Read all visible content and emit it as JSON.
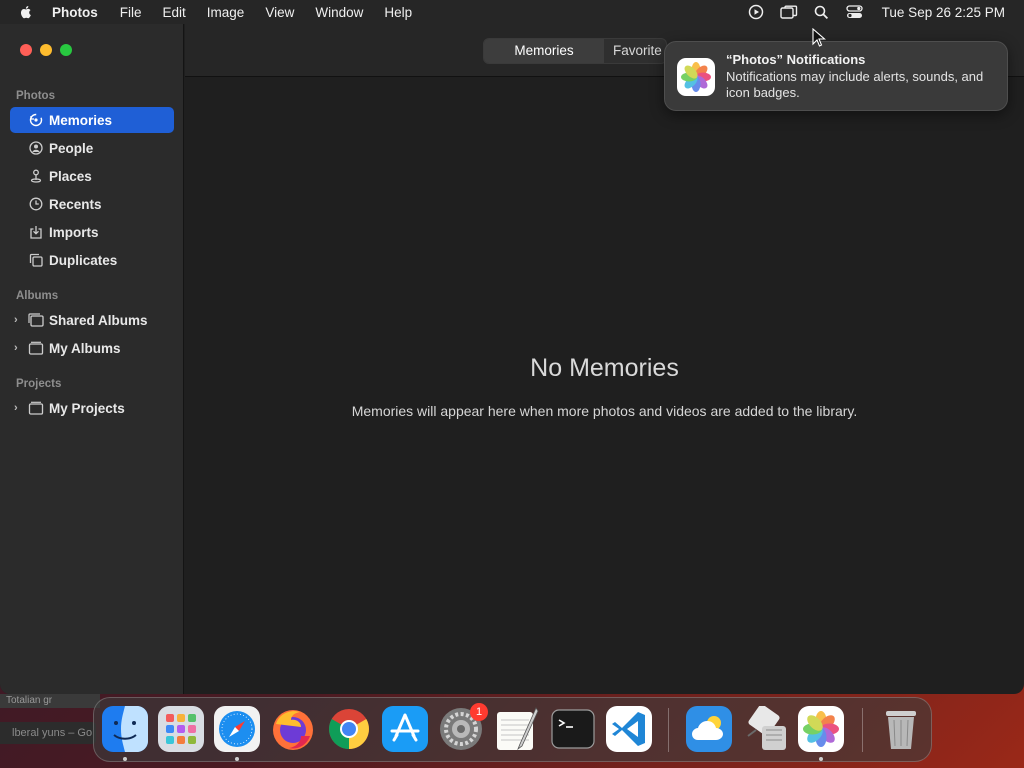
{
  "menubar": {
    "app_name": "Photos",
    "items": [
      "File",
      "Edit",
      "Image",
      "View",
      "Window",
      "Help"
    ],
    "clock": "Tue Sep 26  2:25 PM",
    "status_icons": [
      "screen-record-icon",
      "screen-mirroring-icon",
      "spotlight-search-icon",
      "control-center-icon"
    ]
  },
  "sidebar": {
    "sections": [
      {
        "header": "Photos"
      },
      {
        "header": "Albums"
      },
      {
        "header": "Projects"
      }
    ],
    "items": [
      {
        "label": "Memories",
        "icon": "memories-icon"
      },
      {
        "label": "People",
        "icon": "people-icon"
      },
      {
        "label": "Places",
        "icon": "places-icon"
      },
      {
        "label": "Recents",
        "icon": "recents-icon"
      },
      {
        "label": "Imports",
        "icon": "imports-icon"
      },
      {
        "label": "Duplicates",
        "icon": "duplicates-icon"
      },
      {
        "label": "Shared Albums",
        "icon": "shared-albums-icon"
      },
      {
        "label": "My Albums",
        "icon": "album-folder-icon"
      },
      {
        "label": "My Projects",
        "icon": "project-folder-icon"
      }
    ]
  },
  "toolbar": {
    "tabs": [
      {
        "label": "Memories"
      },
      {
        "label": "Favorite Memories"
      }
    ]
  },
  "main": {
    "empty_title": "No Memories",
    "empty_subtitle": "Memories will appear here when more photos and videos are added to the library."
  },
  "notification": {
    "title": "“Photos” Notifications",
    "body": "Notifications may include alerts, sounds, and icon badges."
  },
  "background": {
    "strip1": "Totalian gr",
    "strip2": "lberal yuns – Go"
  },
  "dock": {
    "apps": [
      "Finder",
      "Launchpad",
      "Safari",
      "Firefox",
      "Chrome",
      "App Store",
      "System Settings",
      "TextEdit",
      "Terminal",
      "Visual Studio Code",
      "Weather",
      "Migration Assistant",
      "Photos",
      "Trash"
    ],
    "settings_badge": "1"
  },
  "colors": {
    "accent": "#1f5fd6",
    "close": "#ff5f57",
    "minimize": "#febc2e",
    "maximize": "#28c840",
    "badge": "#ff3b30"
  }
}
